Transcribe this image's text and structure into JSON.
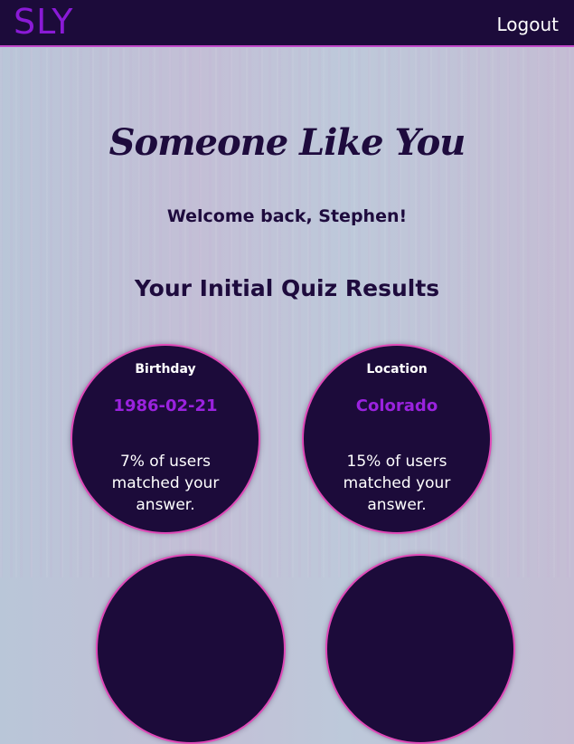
{
  "navbar": {
    "brand": "SLY",
    "logout_label": "Logout"
  },
  "main": {
    "title": "Someone Like You",
    "welcome": "Welcome back, Stephen!",
    "section_title": "Your Initial Quiz Results",
    "cards": [
      {
        "label": "Birthday",
        "answer": "1986-02-21",
        "stat": "7% of users matched your answer."
      },
      {
        "label": "Location",
        "answer": "Colorado",
        "stat": "15% of users matched your answer."
      }
    ]
  },
  "colors": {
    "navbar_bg": "#1c0b3a",
    "brand": "#8a1ad6",
    "accent_border": "#e04ab8",
    "answer_text": "#9a22de",
    "heading_text": "#1e0b3d"
  }
}
